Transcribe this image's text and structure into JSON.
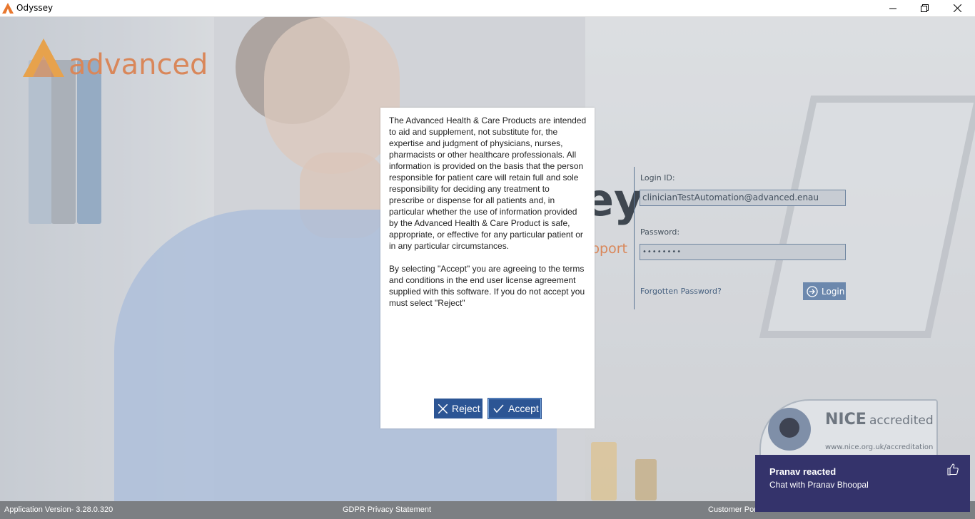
{
  "window": {
    "title": "Odyssey",
    "icons": [
      "app-logo-icon",
      "minimize-icon",
      "restore-icon",
      "close-icon"
    ]
  },
  "brand": {
    "logo_text": "advanced",
    "product_partial": "ey",
    "tagline_partial": "pport",
    "accent_color": "#d9875a"
  },
  "login": {
    "login_id_label": "Login ID:",
    "login_id_value": "clinicianTestAutomation@advanced.enau",
    "password_label": "Password:",
    "password_masked": "••••••••",
    "forgot_link": "Forgotten Password?",
    "login_button": "Login"
  },
  "dialog": {
    "disclaimer": "The Advanced Health & Care Products are intended\nto aid and supplement, not substitute for, the\nexpertise and judgment of physicians, nurses,\npharmacists or other healthcare professionals. All\ninformation is provided on the basis that the person\nresponsible for patient care will retain full and sole\nresponsibility for deciding any treatment to\nprescribe or dispense for all patients and, in\nparticular whether the use of information provided\nby the Advanced Health & Care Product is safe,\nappropriate, or effective for any particular patient or\nin any particular circumstances.\n\nBy selecting \"Accept\" you are agreeing to the terms\nand conditions in the end user license agreement\nsupplied with this software. If you do not accept you\nmust select \"Reject\"",
    "reject_label": "Reject",
    "accept_label": "Accept",
    "button_color": "#2c5594"
  },
  "badge": {
    "nice_word": "NICE",
    "accredited": "accredited",
    "url": "www.nice.org.uk/accreditation"
  },
  "statusbar": {
    "version": "Application Version- 3.28.0.320",
    "gdpr": "GDPR Privacy Statement",
    "customer_portal_partial": "Customer Por"
  },
  "toast": {
    "title": "Pranav reacted",
    "subtitle": "Chat with Pranav Bhoopal",
    "background": "#34336b"
  }
}
